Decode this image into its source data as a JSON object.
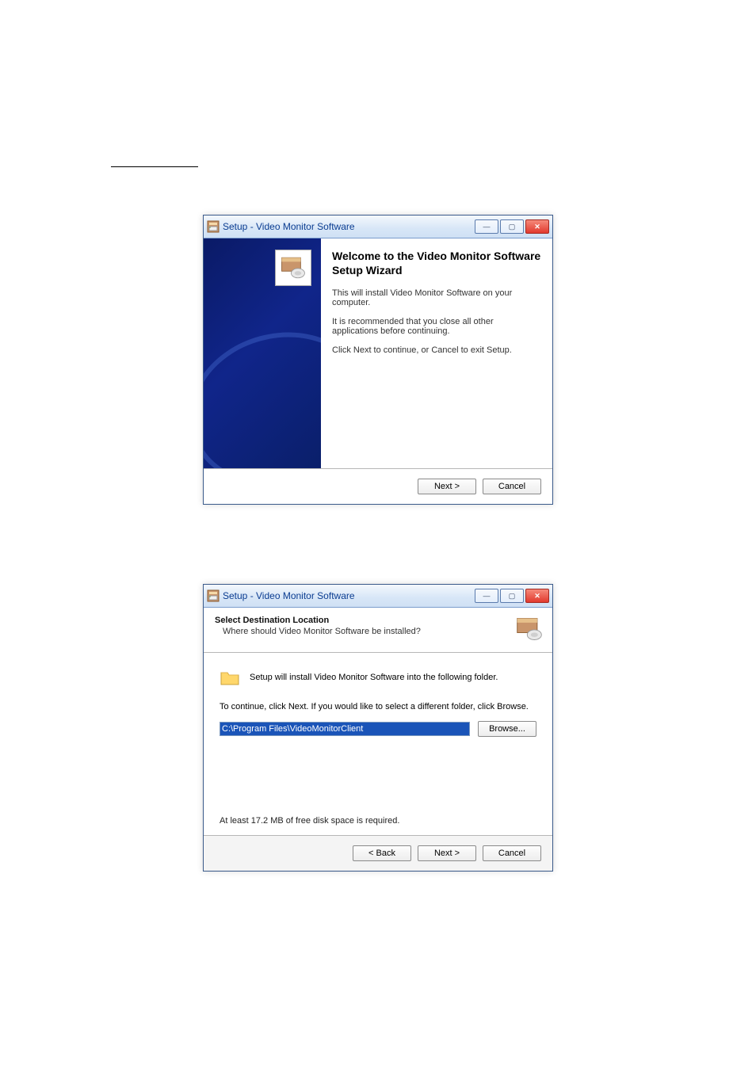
{
  "wizard1": {
    "title": "Setup - Video Monitor Software",
    "heading": "Welcome to the Video Monitor Software Setup Wizard",
    "p1": "This will install Video Monitor Software on your computer.",
    "p2": "It is recommended that you close all other applications before continuing.",
    "p3": "Click Next to continue, or Cancel to exit Setup.",
    "next": "Next >",
    "cancel": "Cancel"
  },
  "wizard2": {
    "title": "Setup - Video Monitor Software",
    "h1": "Select Destination Location",
    "h2": "Where should Video Monitor Software be installed?",
    "intro": "Setup will install Video Monitor Software into the following folder.",
    "hint": "To continue, click Next. If you would like to select a different folder, click Browse.",
    "path": "C:\\Program Files\\VideoMonitorClient",
    "browse": "Browse...",
    "diskreq": "At least 17.2 MB of free disk space is required.",
    "back": "< Back",
    "next": "Next >",
    "cancel": "Cancel"
  },
  "winbtn": {
    "min": "—",
    "max": "▢",
    "close": "✕"
  }
}
